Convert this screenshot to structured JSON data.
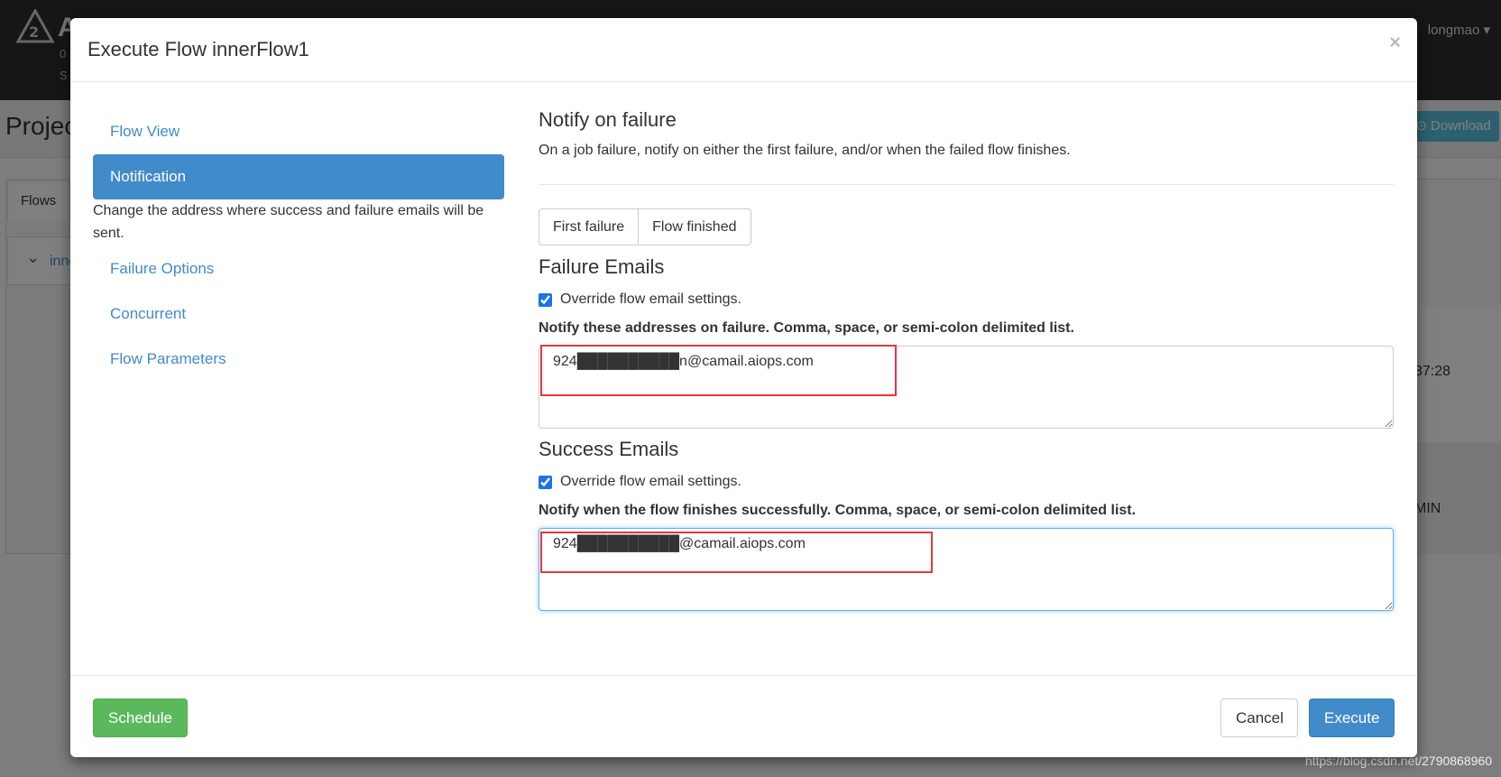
{
  "background": {
    "user_menu": "longmao",
    "project_title": "Projec",
    "download_label": "Download",
    "flows_tab": "Flows",
    "flow_row_name": "inne",
    "time_fragment": "37:28",
    "min_fragment": "MIN",
    "brand_letter": "A",
    "brand_sub1": "0",
    "brand_sub2": "S",
    "watermark": "https://blog.csdn.net/2790868960"
  },
  "modal": {
    "title": "Execute Flow innerFlow1",
    "close": "×",
    "nav": {
      "flow_view": "Flow View",
      "notification": "Notification",
      "notification_desc": "Change the address where success and failure emails will be sent.",
      "failure_options": "Failure Options",
      "concurrent": "Concurrent",
      "flow_parameters": "Flow Parameters"
    },
    "notify": {
      "heading": "Notify on failure",
      "description": "On a job failure, notify on either the first failure, and/or when the failed flow finishes.",
      "first_failure": "First failure",
      "flow_finished": "Flow finished"
    },
    "failure_emails": {
      "heading": "Failure Emails",
      "override_label": "Override flow email settings.",
      "override_checked": true,
      "list_label": "Notify these addresses on failure. Comma, space, or semi-colon delimited list.",
      "value": "924██████████n@camail.aiops.com"
    },
    "success_emails": {
      "heading": "Success Emails",
      "override_label": "Override flow email settings.",
      "override_checked": true,
      "list_label": "Notify when the flow finishes successfully. Comma, space, or semi-colon delimited list.",
      "value": "924██████████@camail.aiops.com"
    },
    "footer": {
      "schedule": "Schedule",
      "cancel": "Cancel",
      "execute": "Execute"
    }
  },
  "colors": {
    "primary": "#428bca",
    "success": "#5cb85c",
    "highlight_box": "#e8363d"
  }
}
